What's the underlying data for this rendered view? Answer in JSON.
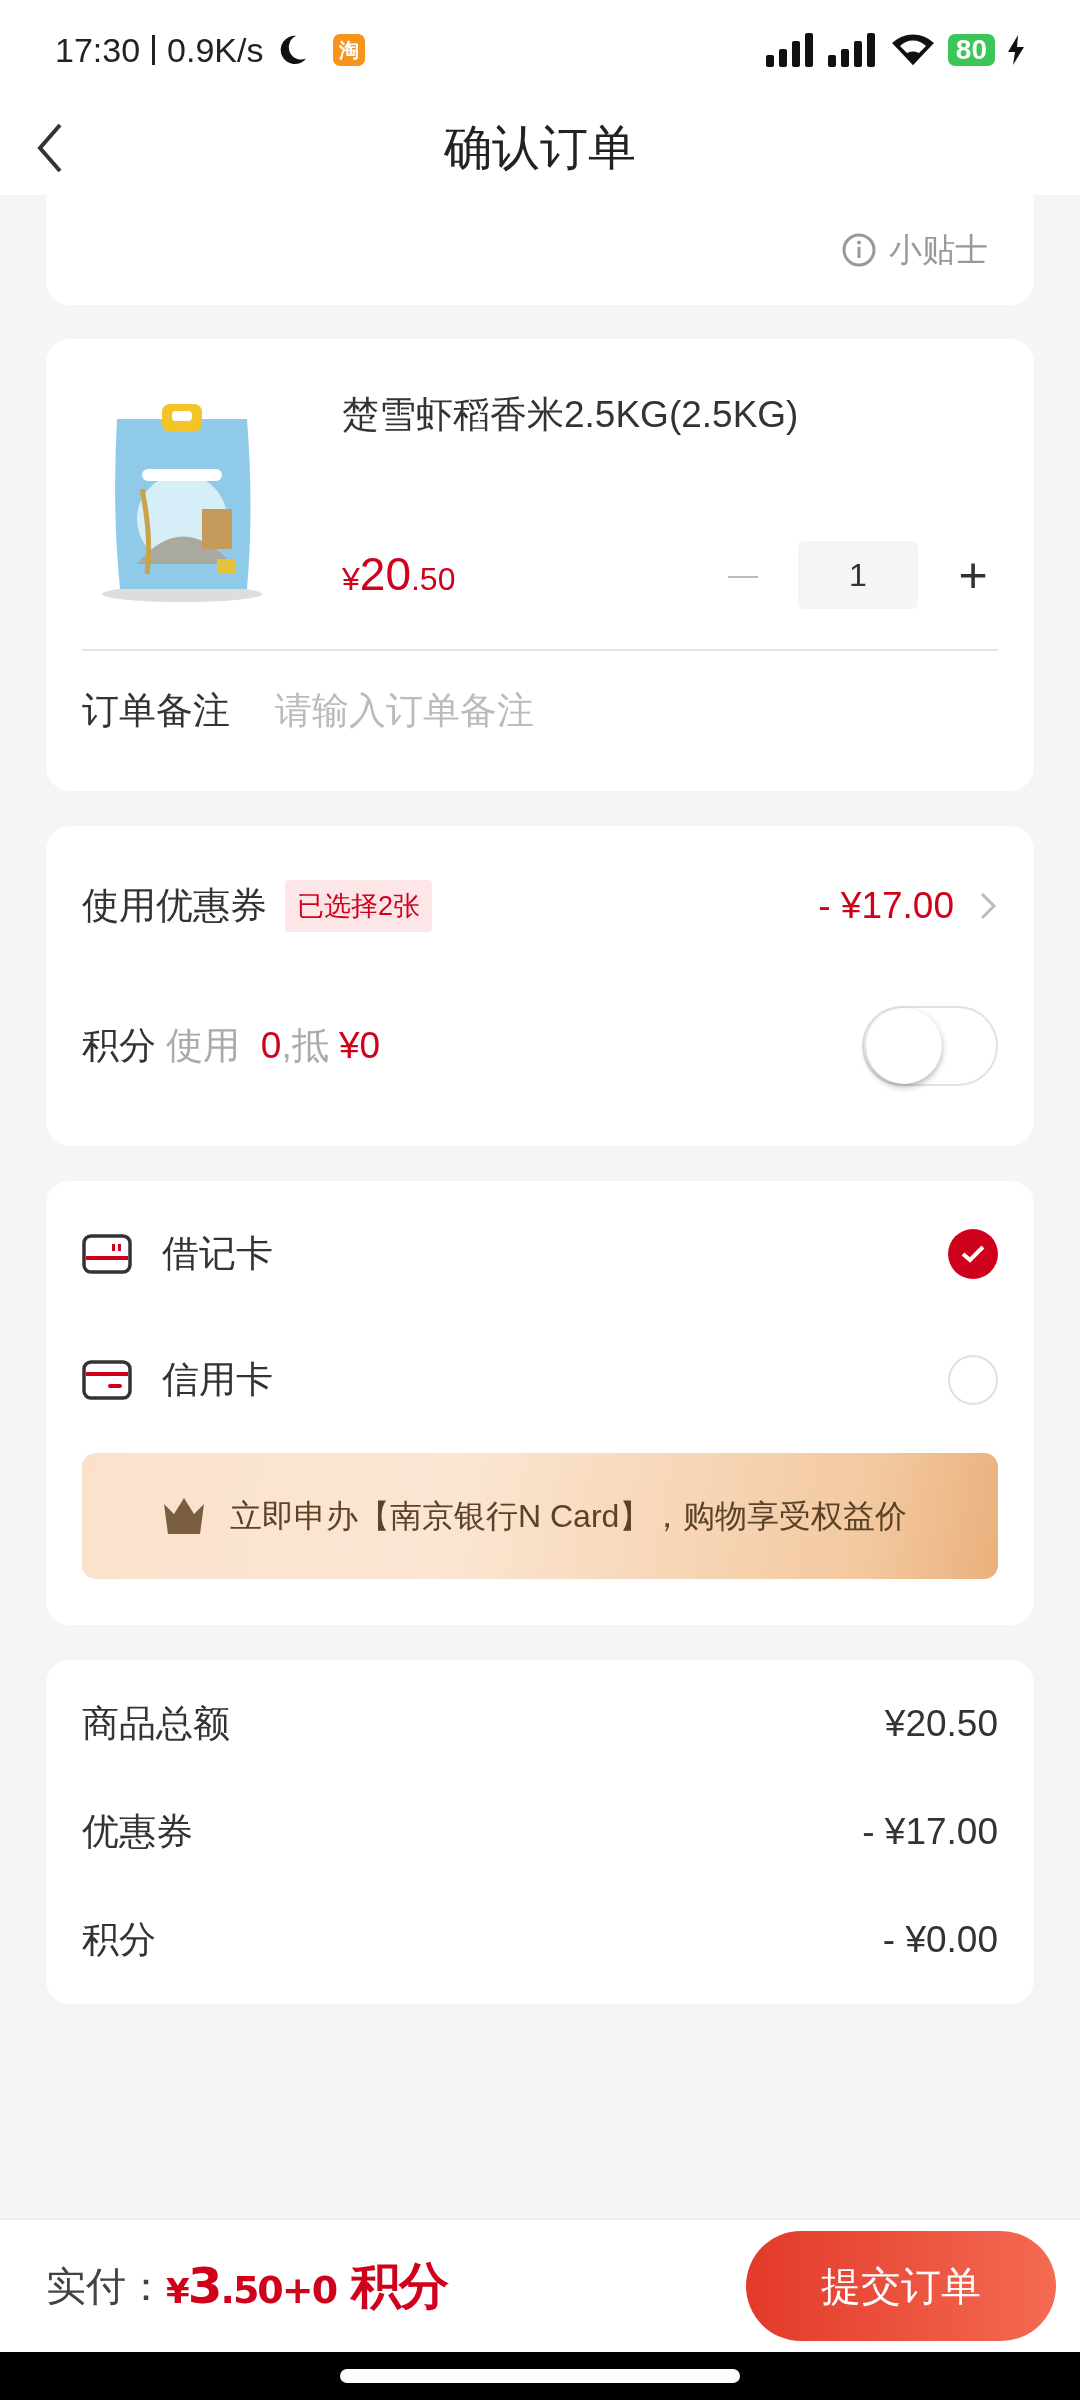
{
  "status_bar": {
    "time": "17:30",
    "speed": "0.9K/s",
    "app_badge": "淘",
    "battery": "80"
  },
  "header": {
    "title": "确认订单"
  },
  "tips": {
    "label": "小贴士"
  },
  "product": {
    "kind": "picture",
    "name": "楚雪虾稻香米2.5KG(2.5KG)",
    "price": {
      "currency": "¥",
      "integer": "20",
      "decimal": ".50"
    },
    "quantity": "1",
    "minus": "—",
    "plus": "+"
  },
  "note": {
    "label": "订单备注",
    "placeholder": "请输入订单备注"
  },
  "coupon": {
    "label": "使用优惠券",
    "tag": "已选择2张",
    "amount": "- ¥17.00"
  },
  "points": {
    "label": "积分",
    "segments": [
      {
        "text": "使用 ",
        "kind": "muted"
      },
      {
        "text": " 0",
        "kind": "accent"
      },
      {
        "text": ",抵 ",
        "kind": "muted"
      },
      {
        "text": "¥0",
        "kind": "accent"
      }
    ],
    "on": false
  },
  "payment_methods": [
    {
      "kind": "debit",
      "label": "借记卡",
      "selected": true
    },
    {
      "kind": "credit",
      "label": "信用卡",
      "selected": false
    }
  ],
  "promo": {
    "text": "立即申办【南京银行N Card】，购物享受权益价"
  },
  "summary": [
    {
      "label": "商品总额",
      "value": "¥20.50"
    },
    {
      "label": "优惠券",
      "value": "- ¥17.00"
    },
    {
      "label": "积分",
      "value": "- ¥0.00"
    }
  ],
  "footer": {
    "label": "实付：",
    "segments": [
      {
        "text": "¥",
        "kind": "symbol"
      },
      {
        "text": "3",
        "kind": "integer"
      },
      {
        "text": ".50+0",
        "kind": "decimal"
      },
      {
        "text": " 积分",
        "kind": "unit"
      }
    ],
    "submit": "提交订单"
  }
}
